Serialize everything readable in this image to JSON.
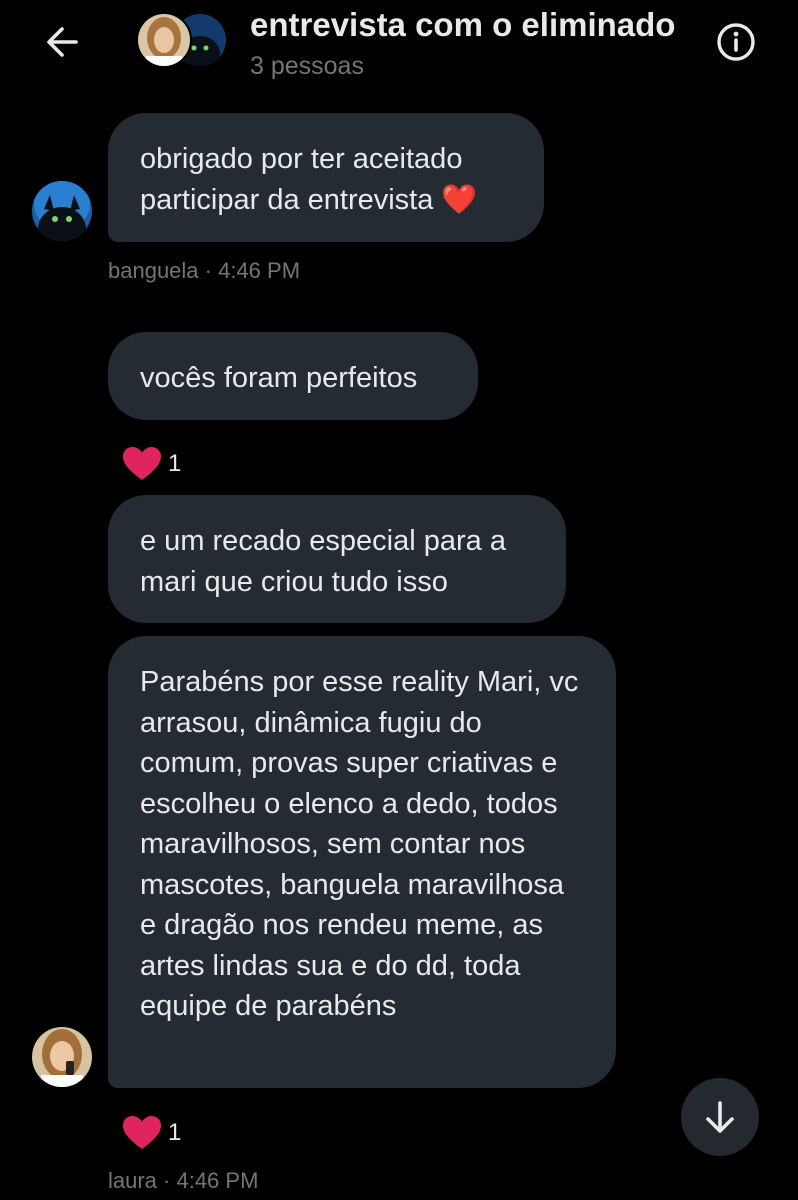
{
  "header": {
    "title": "entrevista com o eliminado",
    "subtitle": "3 pessoas"
  },
  "messages": [
    {
      "text": "obrigado por ter aceitado participar da entrevista ❤️",
      "sender": "banguela",
      "time": "4:46 PM"
    },
    {
      "text": "vocês foram perfeitos",
      "reaction_count": "1"
    },
    {
      "text": "e um recado especial para a mari que criou tudo isso"
    },
    {
      "text": "Parabéns por esse reality Mari, vc arrasou, dinâmica fugiu do comum, provas super criativas e escolheu o elenco a dedo, todos maravilhosos, sem contar nos mascotes, banguela maravilhosa e dragão nos rendeu meme, as artes lindas sua e do dd, toda equipe de parabéns",
      "sender": "laura",
      "time": "4:46 PM",
      "reaction_count": "1"
    }
  ],
  "meta": {
    "banguela": "banguela · 4:46 PM",
    "laura": "laura · 4:46 PM"
  },
  "colors": {
    "background": "#000000",
    "bubble": "#242b33",
    "muted_text": "#71767b",
    "heart": "#e0245e"
  },
  "icons": {
    "back": "arrow-left-icon",
    "info": "info-icon",
    "reaction": "heart-icon",
    "scroll": "arrow-down-icon"
  }
}
